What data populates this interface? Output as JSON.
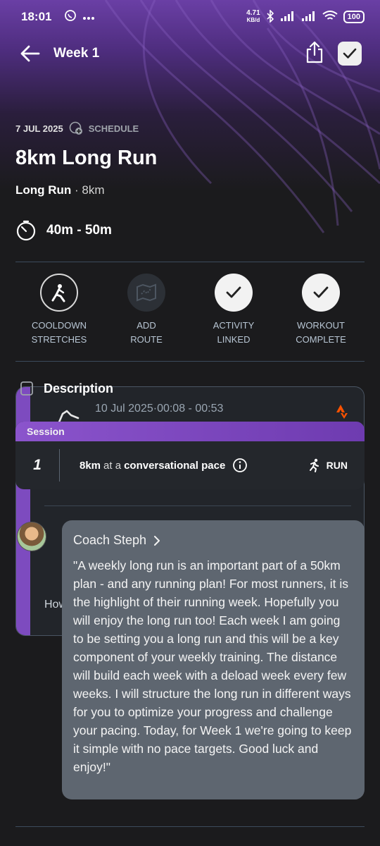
{
  "status_bar": {
    "time": "18:01",
    "net_speed_value": "4.71",
    "net_speed_unit": "KB/d",
    "battery": "100"
  },
  "app_bar": {
    "title": "Week 1"
  },
  "workout": {
    "date": "7 JUL 2025",
    "schedule_label": "SCHEDULE",
    "title": "8km Long Run",
    "type": "Long Run",
    "distance": "· 8km",
    "duration": "40m - 50m"
  },
  "actions": [
    {
      "label_line1": "COOLDOWN",
      "label_line2": "STRETCHES"
    },
    {
      "label_line1": "ADD",
      "label_line2": "ROUTE"
    },
    {
      "label_line1": "ACTIVITY",
      "label_line2": "LINKED"
    },
    {
      "label_line1": "WORKOUT",
      "label_line2": "COMPLETE"
    }
  ],
  "description": {
    "header": "Description",
    "activity_datetime": "10 Jul 2025·00:08 - 00:53",
    "prompt_partial": "How"
  },
  "session": {
    "header": "Session",
    "number": "1",
    "distance": "8km",
    "connector": "at a",
    "pace": "conversational pace",
    "sport": "RUN"
  },
  "coach": {
    "name": "Coach Steph",
    "message": "\"A weekly long run is an important part of a 50km plan - and any running plan! For most runners, it is the highlight of their running week. Hopefully you will enjoy the long run too! Each week I am going to be setting you a long run and this will be a key component of your weekly training. The distance will build each week with a deload week every few weeks. I will structure the long run in different ways for you to optimize your progress and challenge your pacing. Today, for Week 1 we're going to keep it simple with no pace targets. Good luck and enjoy!\""
  },
  "colors": {
    "accent_purple": "#7d4bbf",
    "background": "#1b1b1d",
    "strava_orange": "#fc5200"
  }
}
